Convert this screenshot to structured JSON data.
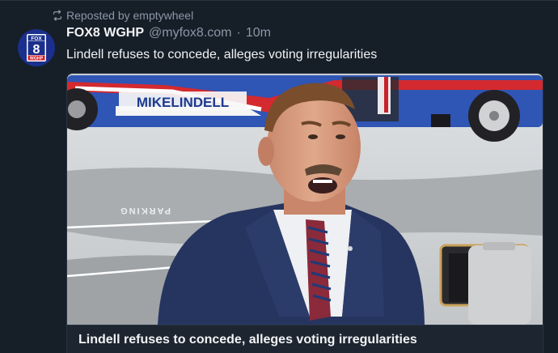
{
  "repost": {
    "label": "Reposted by emptywheel",
    "icon": "repost-icon"
  },
  "author": {
    "name": "FOX8 WGHP",
    "handle": "@myfox8.com",
    "separator": "·",
    "time": "10m",
    "avatar": {
      "top_text": "FOX",
      "number": "8",
      "bottom_text": "WGHP"
    }
  },
  "post": {
    "text": "Lindell refuses to concede, alleges voting irregularities"
  },
  "card": {
    "title": "Lindell refuses to concede, alleges voting irregularities",
    "image": {
      "bus_lettering": "MIKELINDELL",
      "pavement_lettering": "PARKING"
    }
  },
  "colors": {
    "background": "#161e27",
    "text_primary": "#f1f3f5",
    "text_secondary": "#8b98a8",
    "border": "#2a3442",
    "card_footer": "#1d2530"
  }
}
